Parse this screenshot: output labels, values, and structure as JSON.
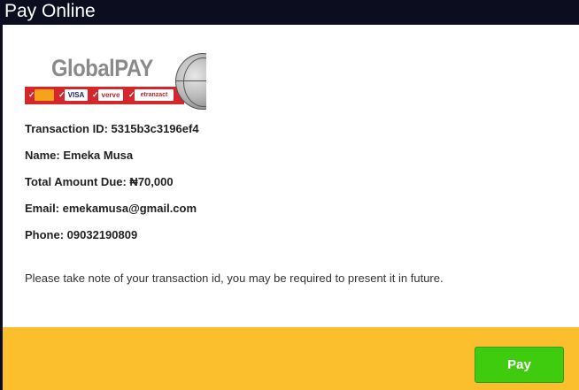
{
  "window": {
    "title": "Pay Online"
  },
  "logo": {
    "brand": "GlobalPAY",
    "payment_methods": [
      "MasterCard",
      "VISA",
      "Verve",
      "eTranzact"
    ]
  },
  "transaction": {
    "id_line": "Transaction ID: 5315b3c3196ef4",
    "name_line": "Name: Emeka Musa",
    "amount_line": "Total Amount Due: ₦70,000",
    "email_line": "Email: emekamusa@gmail.com",
    "phone_line": "Phone: 09032190809"
  },
  "note": "Please take note of your transaction id, you may be required to present it in future.",
  "footer": {
    "pay_label": "Pay"
  },
  "colors": {
    "titlebar": "#0c0e1f",
    "footer": "#fbbf2d",
    "pay_button": "#3fcc0e",
    "logo_strip": "#d4262b"
  }
}
